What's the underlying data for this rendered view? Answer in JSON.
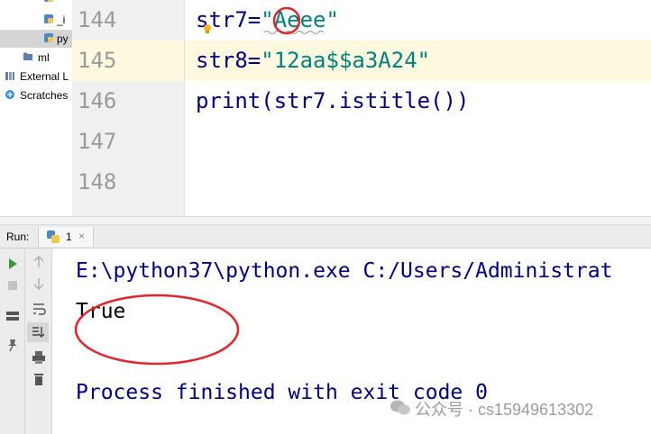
{
  "project_tree": {
    "items": [
      {
        "label": "_i"
      },
      {
        "label": "py"
      },
      {
        "label": "ml"
      },
      {
        "label": "External L"
      },
      {
        "label": "Scratches"
      }
    ]
  },
  "editor": {
    "line_numbers": [
      "144",
      "145",
      "146",
      "147",
      "148"
    ],
    "lines": [
      {
        "lhs": "str7=",
        "quote": "\"",
        "value": "Aeee",
        "end_quote": "\""
      },
      {
        "lhs": "str8=",
        "quote": "\"",
        "value": "12aa$$a3A24",
        "end_quote": "\""
      },
      {
        "code": "print(str7.istitle())"
      }
    ]
  },
  "run_panel": {
    "label": "Run:",
    "tab_name": "1",
    "tab_close": "×",
    "output": {
      "command": "E:\\python37\\python.exe C:/Users/Administrat",
      "result": "True",
      "exit_message": "Process finished with exit code 0"
    }
  },
  "watermark": "公众号 · cs15949613302",
  "colors": {
    "string": "#008080",
    "keyword": "#000080",
    "console_text": "#000000",
    "console_exit": "#000080",
    "annotation_red": "#e0262c",
    "current_line": "#fcf9df"
  }
}
